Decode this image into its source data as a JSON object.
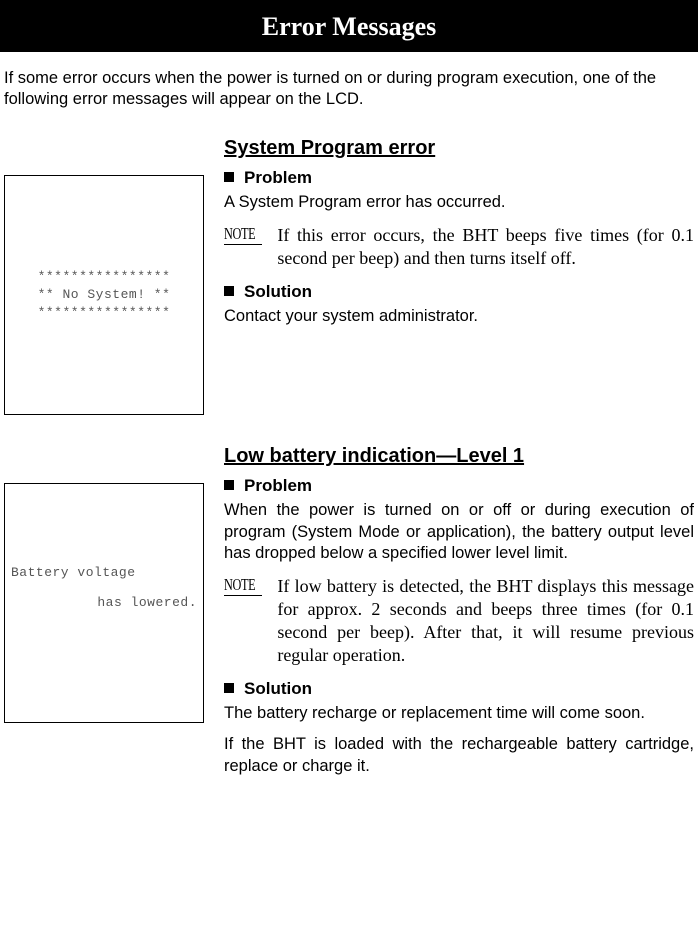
{
  "header": {
    "title": "Error Messages"
  },
  "intro": "If some error occurs when the power is turned on or during program execution, one of the following error messages will appear on the LCD.",
  "sections": [
    {
      "title": "System Program error",
      "lcd": {
        "line1": "****************",
        "line2": "** No System! **",
        "line3": "****************"
      },
      "problem_label": "Problem",
      "problem_text": "A System Program error has occurred.",
      "note_label": "NOTE",
      "note_text": "If this error occurs, the BHT beeps five times (for 0.1 second per beep) and then turns itself off.",
      "solution_label": "Solution",
      "solution_text": "Contact your system administrator."
    },
    {
      "title": "Low battery indication—Level 1",
      "lcd": {
        "line1": "Battery voltage",
        "line2": "has lowered."
      },
      "problem_label": "Problem",
      "problem_text": "When the power is turned on or off or during execution of program (System Mode or application), the battery output level has dropped below a specified lower level limit.",
      "note_label": "NOTE",
      "note_text": "If low battery is detected, the BHT displays this message for approx. 2 seconds and beeps three times (for 0.1 second per beep).  After that, it will resume previous regular operation.",
      "solution_label": "Solution",
      "solution_text1": "The battery recharge or replacement time will come soon.",
      "solution_text2": "If the BHT is loaded with the rechargeable battery cartridge, replace or charge it."
    }
  ]
}
